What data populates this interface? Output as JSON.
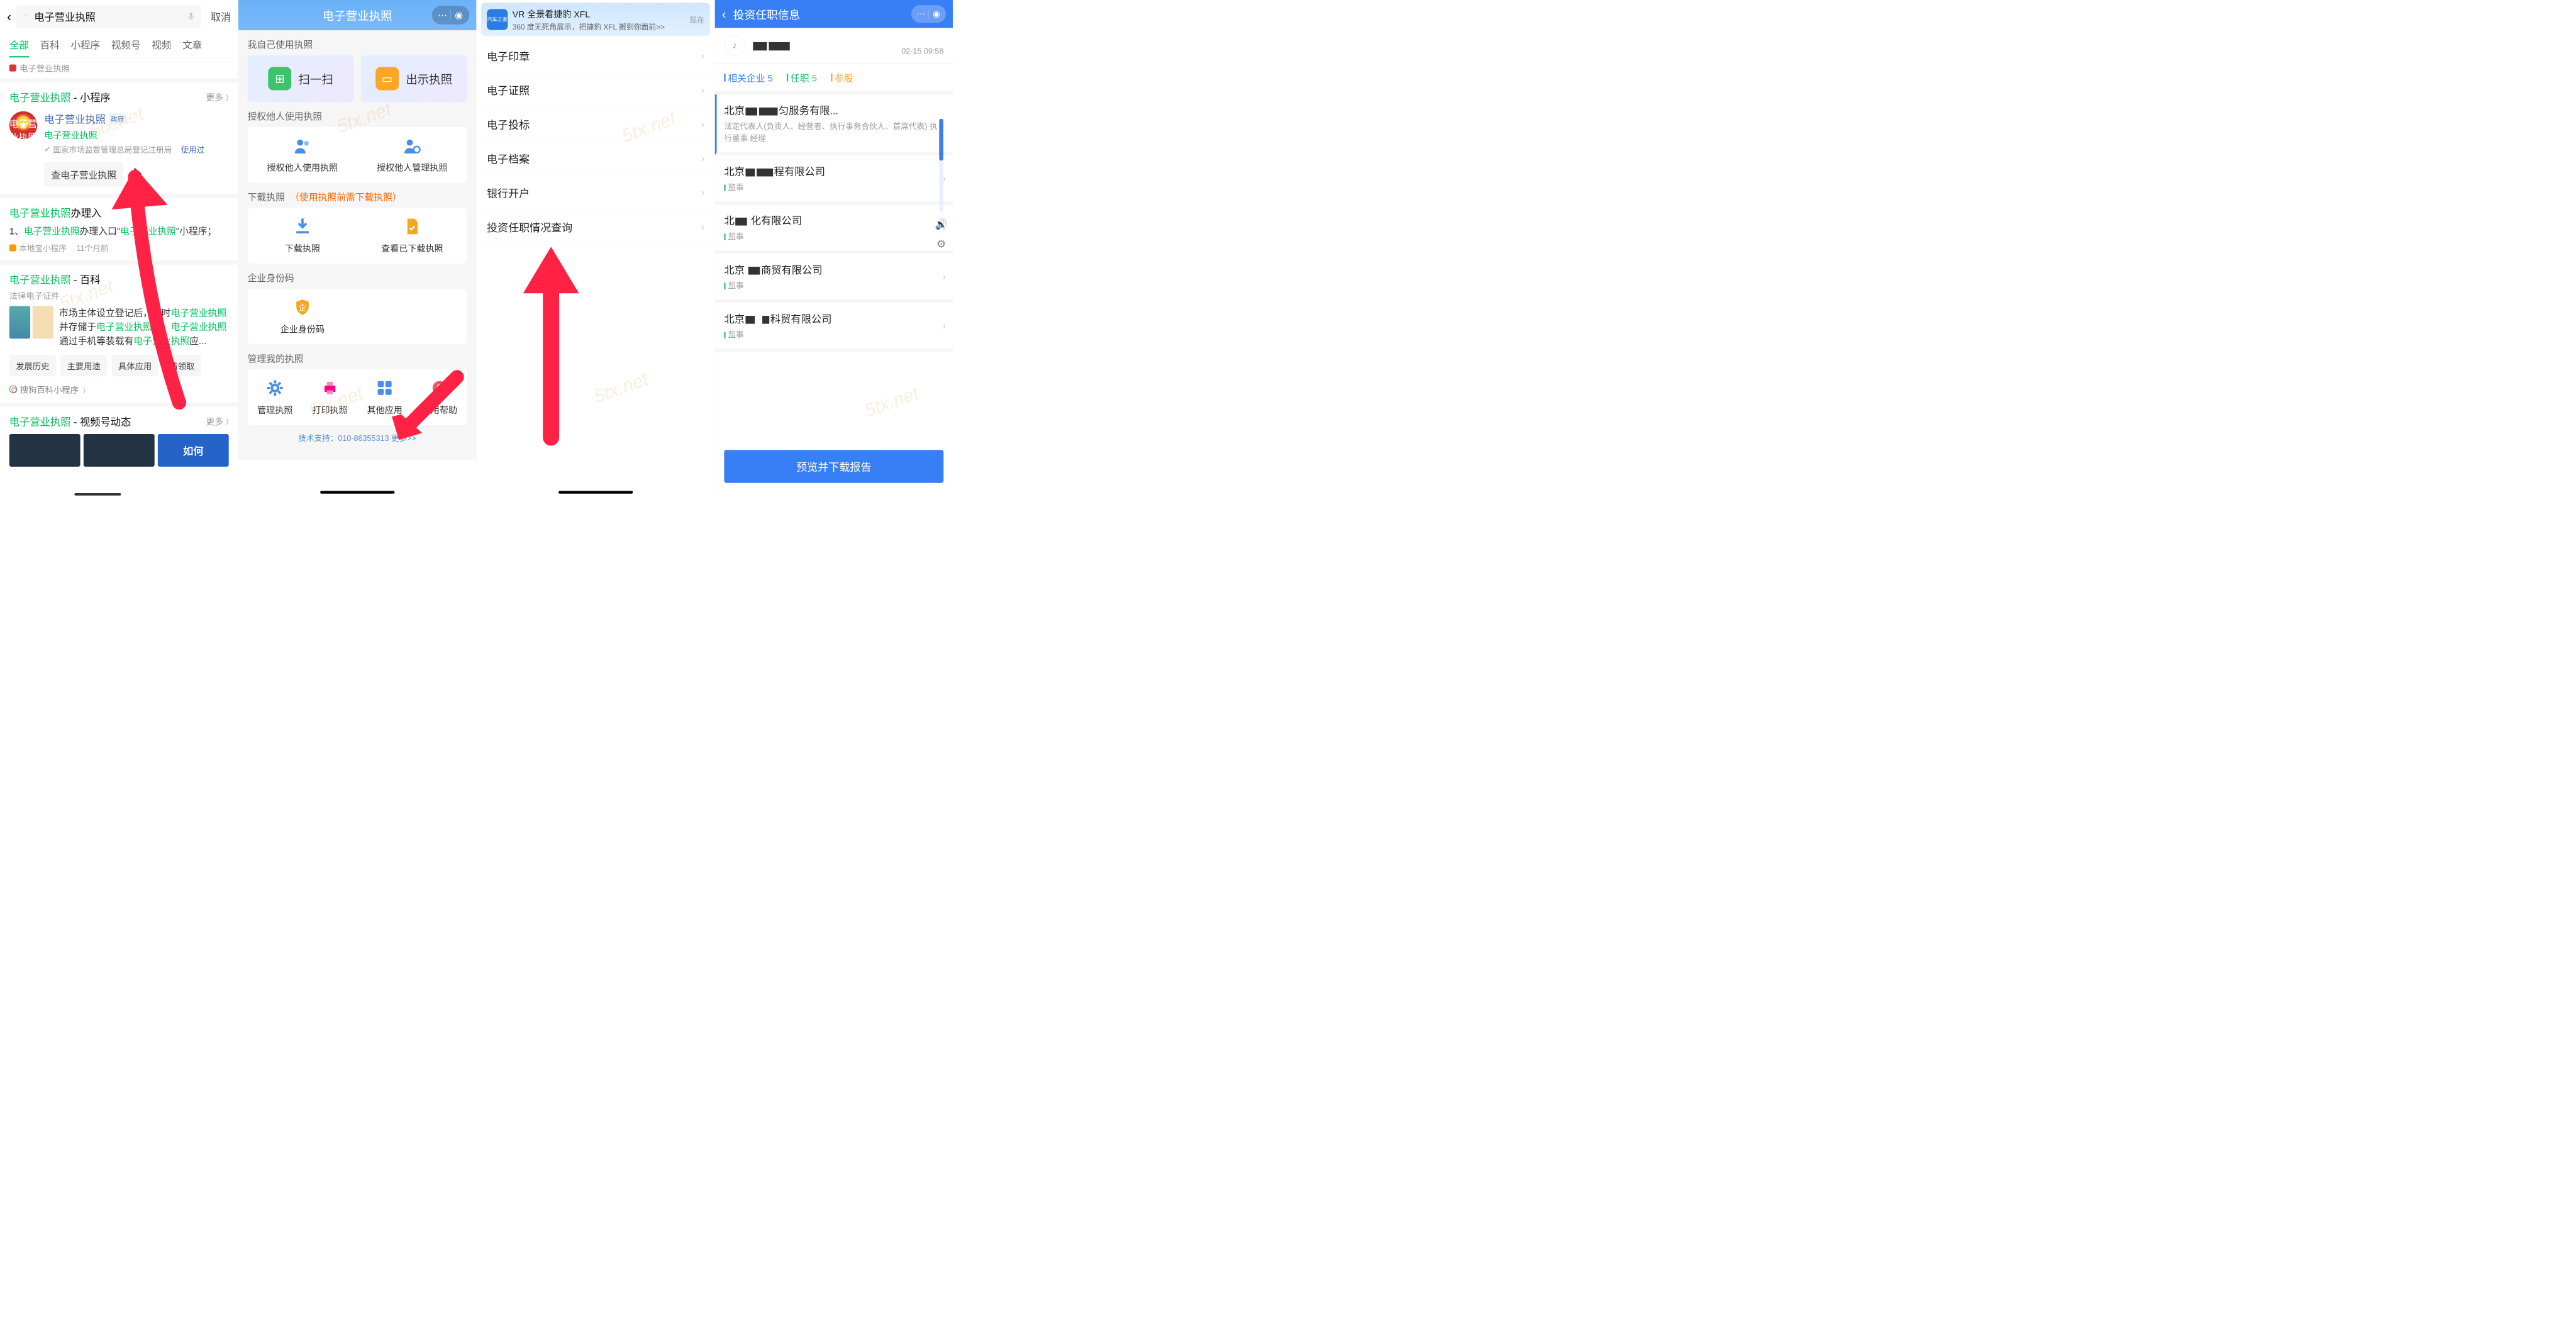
{
  "watermark": "5tx.net",
  "panel1": {
    "search_text": "电子营业执照",
    "cancel": "取消",
    "tabs": [
      "全部",
      "百科",
      "小程序",
      "视频号",
      "视频",
      "文章"
    ],
    "prev_hint": "电子营业执照",
    "sec_mp": {
      "title_green": "电子营业执照",
      "title_rest": " - 小程序",
      "more": "更多"
    },
    "mp": {
      "name": "电子营业执照",
      "gov": "政府",
      "sub": "电子营业执照",
      "org": "国家市场监督管理总局登记注册局",
      "used": "使用过",
      "btn": "查电子营业执照"
    },
    "sec_entry": {
      "title_green": "电子营业执照",
      "title_rest": "办理入",
      "line_pre": "1、",
      "line_g1": "电子营业执照",
      "line_mid": "办理入口\"",
      "line_g2": "电子营业执照",
      "line_end": "\"小程序；",
      "meta_src": "本地宝小程序",
      "meta_time": "11个月前"
    },
    "sec_baike": {
      "title_green": "电子营业执照",
      "title_rest": " - 百科",
      "sub": "法律电子证件",
      "desc_p1": "市场主体设立登记后，即时",
      "desc_g1": "电子营业执照",
      "desc_p2": "并存储于",
      "desc_g2": "电子营业执照",
      "desc_p3": "库。",
      "desc_g3": "电子营业执照",
      "desc_p4": "通过手机等装载有",
      "desc_g4": "电子营业执照",
      "desc_p5": "应...",
      "chips": [
        "发展历史",
        "主要用途",
        "具体应用",
        "情领取"
      ],
      "sogou": "搜狗百科小程序"
    },
    "sec_video": {
      "title_green": "电子营业执照",
      "title_rest": " - 视频号动态",
      "more": "更多",
      "thumb_label": "如何"
    }
  },
  "panel2": {
    "title": "电子营业执照",
    "sec_used": "我自己使用执照",
    "card_scan": "扫一扫",
    "card_show": "出示执照",
    "sec_auth": "授权他人使用执照",
    "auth1": "授权他人使用执照",
    "auth2": "授权他人管理执照",
    "sec_dl": "下载执照",
    "sec_dl_warn": "（使用执照前需下载执照）",
    "dl1": "下载执照",
    "dl2": "查看已下载执照",
    "sec_code": "企业身份码",
    "code1": "企业身份码",
    "sec_manage": "管理我的执照",
    "m1": "管理执照",
    "m2": "打印执照",
    "m3": "其他应用",
    "m4": "使用帮助",
    "footer": "技术支持：010-86355313  更多>>"
  },
  "panel3": {
    "ad": {
      "brand": "汽车之家",
      "title": "VR 全景看捷豹 XFL",
      "sub": "360 度无死角展示，把捷豹 XFL 搬到你面前>>",
      "time": "现在"
    },
    "items": [
      "电子印章",
      "电子证照",
      "电子投标",
      "电子档案",
      "银行开户",
      "投资任职情况查询"
    ]
  },
  "panel4": {
    "title": "投资任职信息",
    "timestamp": "02-15 09:58",
    "tabs": [
      {
        "label": "相关企业 5",
        "active": true
      },
      {
        "label": "任职 5",
        "active": false
      },
      {
        "label": "参股",
        "active": false
      }
    ],
    "items": [
      {
        "prefix": "北京",
        "suffix": "匀服务有限...",
        "role": "法定代表人(负责人、经营者、执行事务合伙人、首席代表) 执行董事 经理",
        "hi": true
      },
      {
        "prefix": "北京",
        "suffix": "程有限公司",
        "role": "监事"
      },
      {
        "prefix": "北",
        "suffix": "化有限公司",
        "role": "监事"
      },
      {
        "prefix": "北京",
        "suffix": "商贸有限公司",
        "role": "监事"
      },
      {
        "prefix": "北京",
        "suffix": "科贸有限公司",
        "role": "监事"
      }
    ],
    "button": "预览并下载报告"
  }
}
